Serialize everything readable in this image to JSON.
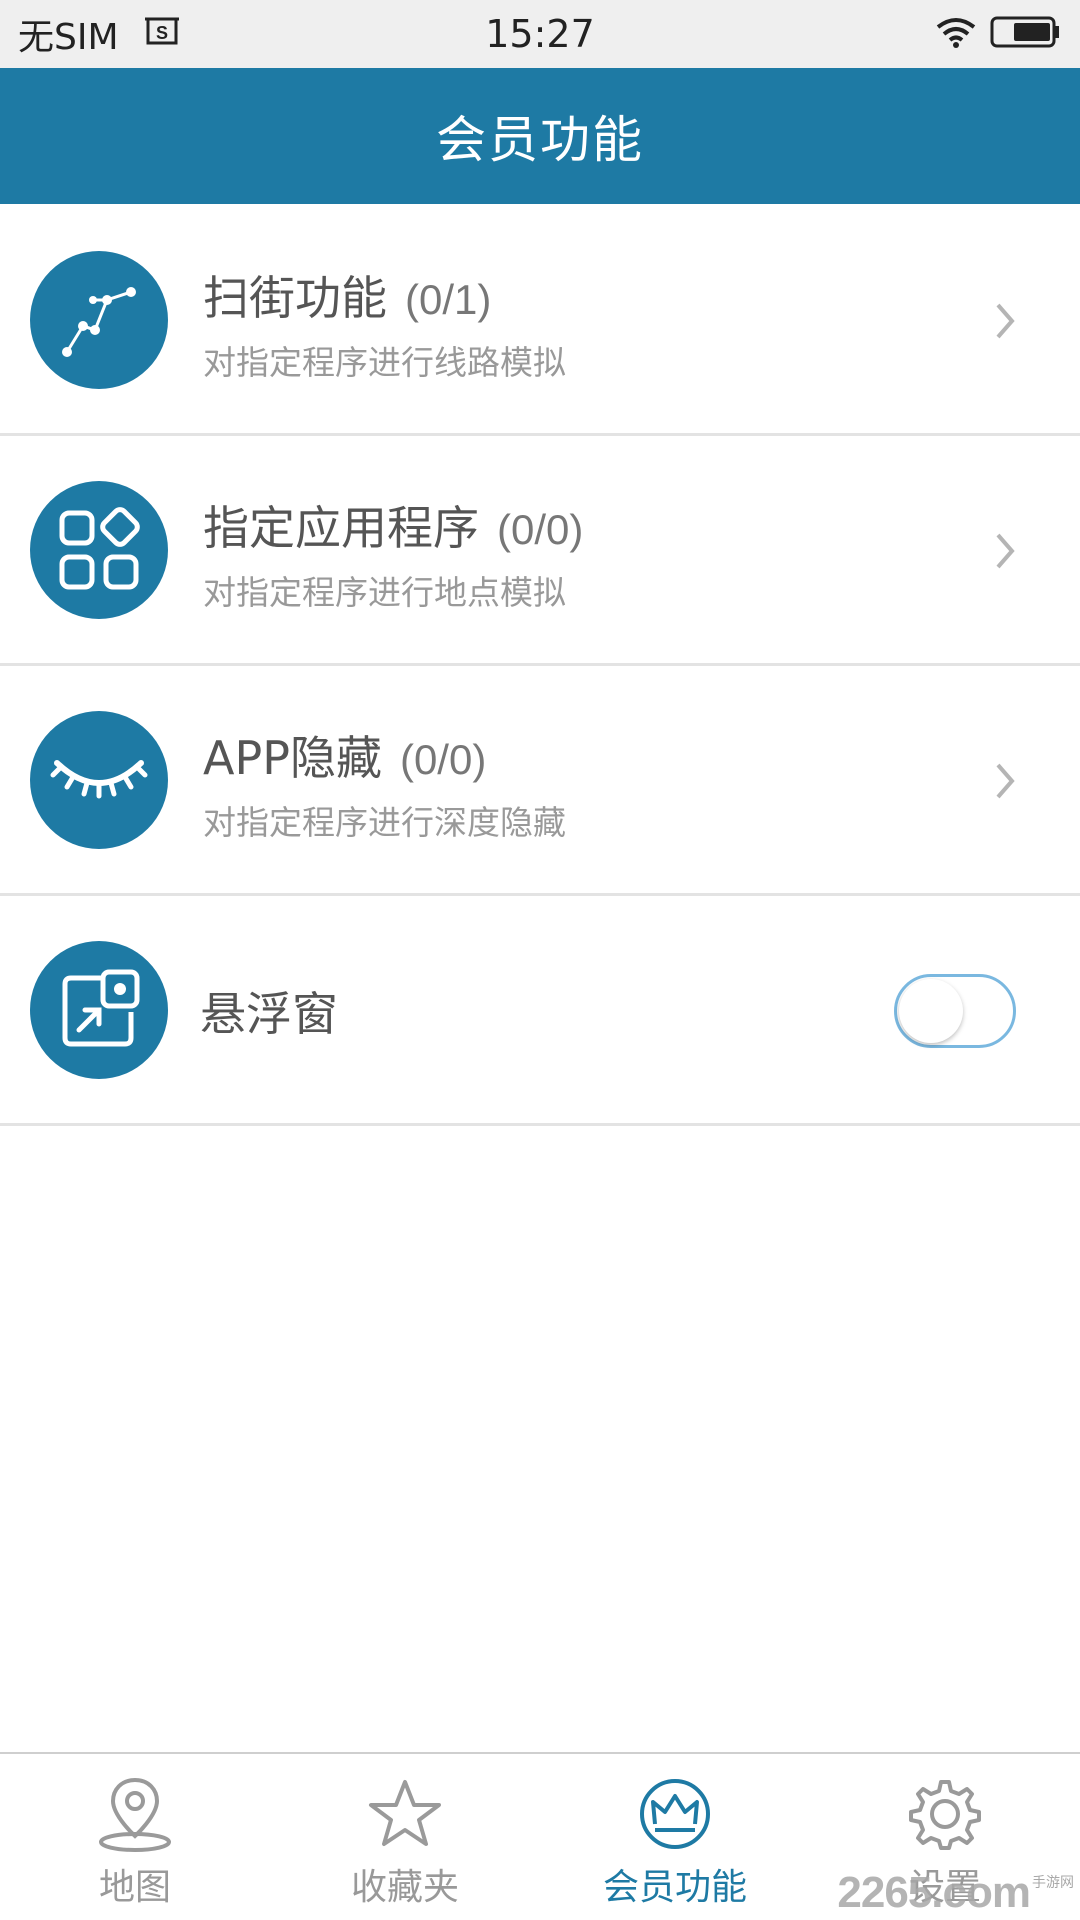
{
  "status_bar": {
    "carrier": "无SIM",
    "time": "15:27"
  },
  "header": {
    "title": "会员功能"
  },
  "features": [
    {
      "title": "扫街功能",
      "count": "(0/1)",
      "subtitle": "对指定程序进行线路模拟",
      "icon": "route-icon"
    },
    {
      "title": "指定应用程序",
      "count": "(0/0)",
      "subtitle": "对指定程序进行地点模拟",
      "icon": "apps-grid-icon"
    },
    {
      "title": "APP隐藏",
      "count": "(0/0)",
      "subtitle": "对指定程序进行深度隐藏",
      "icon": "closed-eye-icon"
    },
    {
      "title": "悬浮窗",
      "icon": "floating-window-icon",
      "toggle_on": false
    }
  ],
  "bottom_nav": {
    "items": [
      {
        "label": "地图",
        "icon": "map-pin-icon",
        "active": false
      },
      {
        "label": "收藏夹",
        "icon": "star-icon",
        "active": false
      },
      {
        "label": "会员功能",
        "icon": "crown-icon",
        "active": true
      },
      {
        "label": "设置",
        "icon": "gear-icon",
        "active": false
      }
    ]
  },
  "watermark": {
    "brand": "2265.com",
    "subtext": "手游网"
  },
  "colors": {
    "primary": "#1e7aa4",
    "status_bar_bg": "#efefef",
    "toggle_border": "#7ab8e0"
  }
}
